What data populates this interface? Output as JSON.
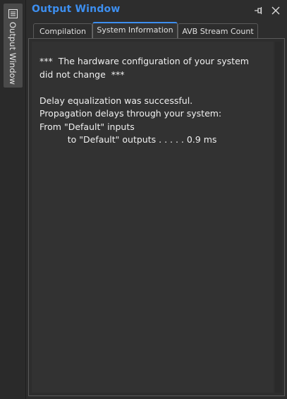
{
  "dock": {
    "tab_label": "Output Window",
    "icon": "list-window-icon"
  },
  "window": {
    "title": "Output Window",
    "title_color": "#3d8ff0",
    "pin_icon": "pin-icon",
    "close_icon": "close-icon"
  },
  "tabs": [
    {
      "label": "Compilation",
      "active": false
    },
    {
      "label": "System Information",
      "active": true
    },
    {
      "label": "AVB Stream Count",
      "active": false
    }
  ],
  "output": {
    "lines": [
      "***  The hardware configuration of your system",
      "did not change  ***",
      "",
      "Delay equalization was successful.",
      "Propagation delays through your system:",
      "From \"Default\" inputs",
      "          to \"Default\" outputs . . . . . 0.9 ms"
    ]
  }
}
